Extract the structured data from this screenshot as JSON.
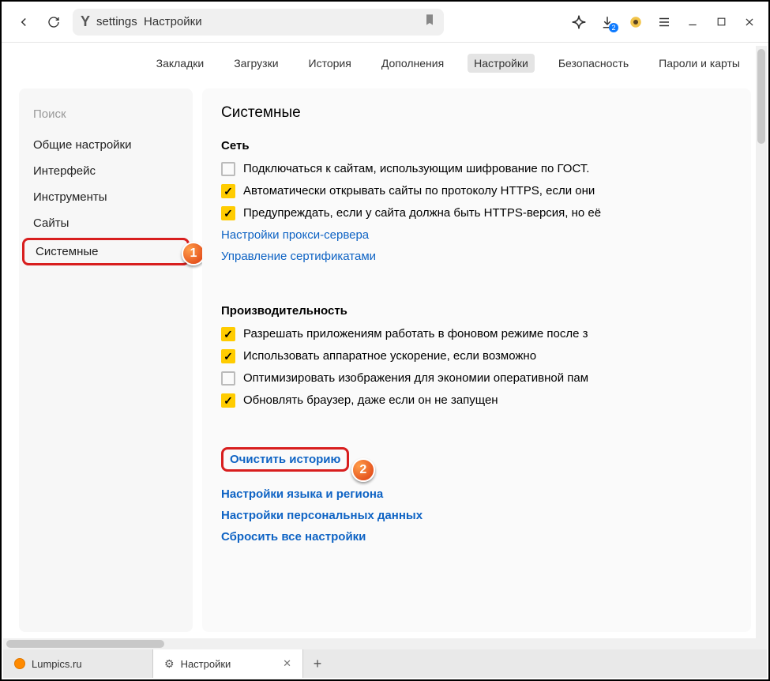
{
  "toolbar": {
    "address": "settings  Настройки",
    "download_badge": "2"
  },
  "nav": {
    "items": [
      "Закладки",
      "Загрузки",
      "История",
      "Дополнения",
      "Настройки",
      "Безопасность",
      "Пароли и карты"
    ],
    "active_index": 4
  },
  "sidebar": {
    "search_placeholder": "Поиск",
    "items": [
      "Общие настройки",
      "Интерфейс",
      "Инструменты",
      "Сайты",
      "Системные"
    ],
    "selected_index": 4
  },
  "content": {
    "title": "Системные",
    "sections": [
      {
        "title": "Сеть",
        "checkboxes": [
          {
            "checked": false,
            "label": "Подключаться к сайтам, использующим шифрование по ГОСТ."
          },
          {
            "checked": true,
            "label": "Автоматически открывать сайты по протоколу HTTPS, если они"
          },
          {
            "checked": true,
            "label": "Предупреждать, если у сайта должна быть HTTPS-версия, но её"
          }
        ],
        "links": [
          "Настройки прокси-сервера",
          "Управление сертификатами"
        ]
      },
      {
        "title": "Производительность",
        "checkboxes": [
          {
            "checked": true,
            "label": "Разрешать приложениям работать в фоновом режиме после з"
          },
          {
            "checked": true,
            "label": "Использовать аппаратное ускорение, если возможно"
          },
          {
            "checked": false,
            "label": "Оптимизировать изображения для экономии оперативной пам"
          },
          {
            "checked": true,
            "label": "Обновлять браузер, даже если он не запущен"
          }
        ],
        "links": []
      }
    ],
    "bottom_links": [
      "Очистить историю",
      "Настройки языка и региона",
      "Настройки персональных данных",
      "Сбросить все настройки"
    ]
  },
  "tabs": [
    {
      "label": "Lumpics.ru",
      "favicon": "orange",
      "active": false
    },
    {
      "label": "Настройки",
      "favicon": "gear",
      "active": true
    }
  ],
  "markers": {
    "one": "1",
    "two": "2"
  }
}
